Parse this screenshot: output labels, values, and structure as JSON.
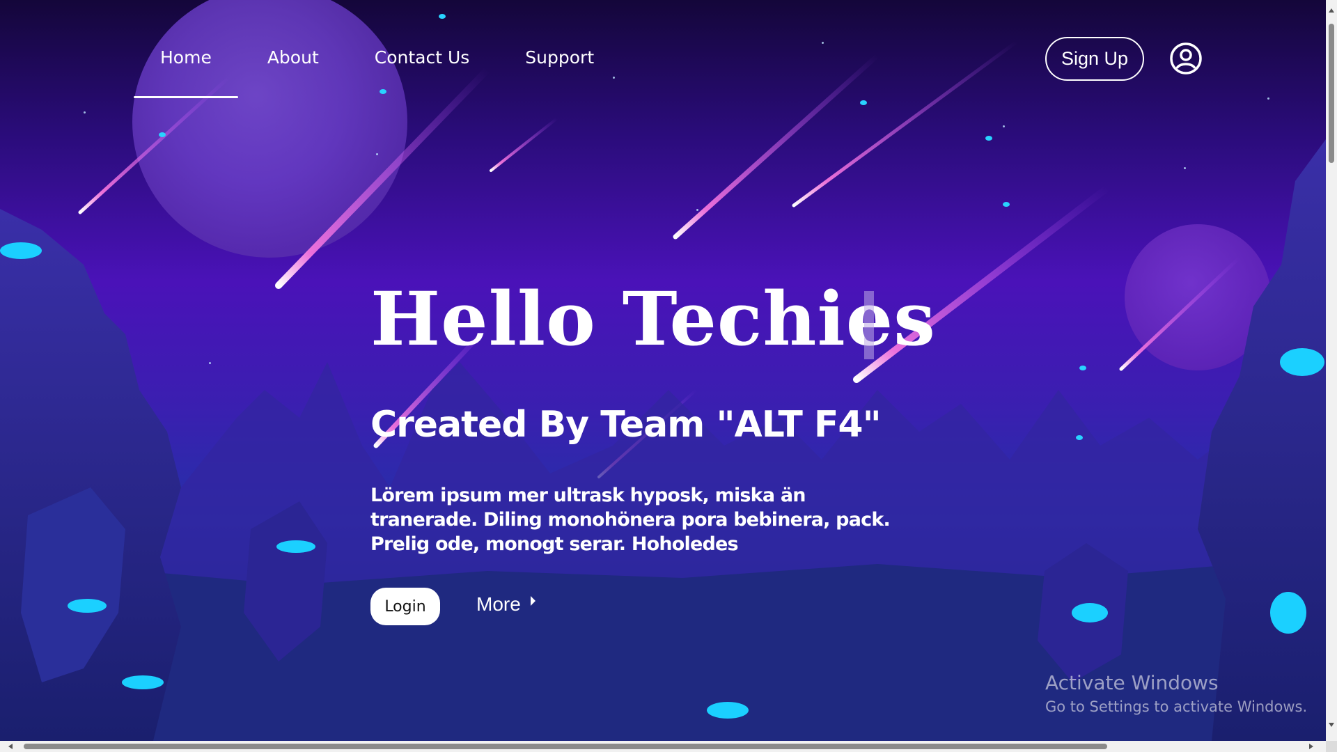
{
  "nav": {
    "items": [
      {
        "label": "Home",
        "active": true
      },
      {
        "label": "About",
        "active": false
      },
      {
        "label": "Contact Us",
        "active": false
      },
      {
        "label": "Support",
        "active": false
      }
    ],
    "signup_label": "Sign Up",
    "user_icon": "user-circle-icon"
  },
  "hero": {
    "title": "Hello Techies",
    "subtitle": "Created By Team \"ALT F4\"",
    "description": "Lörem ipsum mer ultrask hyposk, miska än tranerade. Diling monohönera pora bebinera, pack. Prelig ode, monogt serar. Hoholedes",
    "login_label": "Login",
    "more_label": "More"
  },
  "watermark": {
    "title": "Activate Windows",
    "subtitle": "Go to Settings to activate Windows."
  },
  "colors": {
    "accent_cyan": "#29d3ff",
    "meteor_pink": "#ff6ad5",
    "sky_purple": "#4a12b8"
  }
}
